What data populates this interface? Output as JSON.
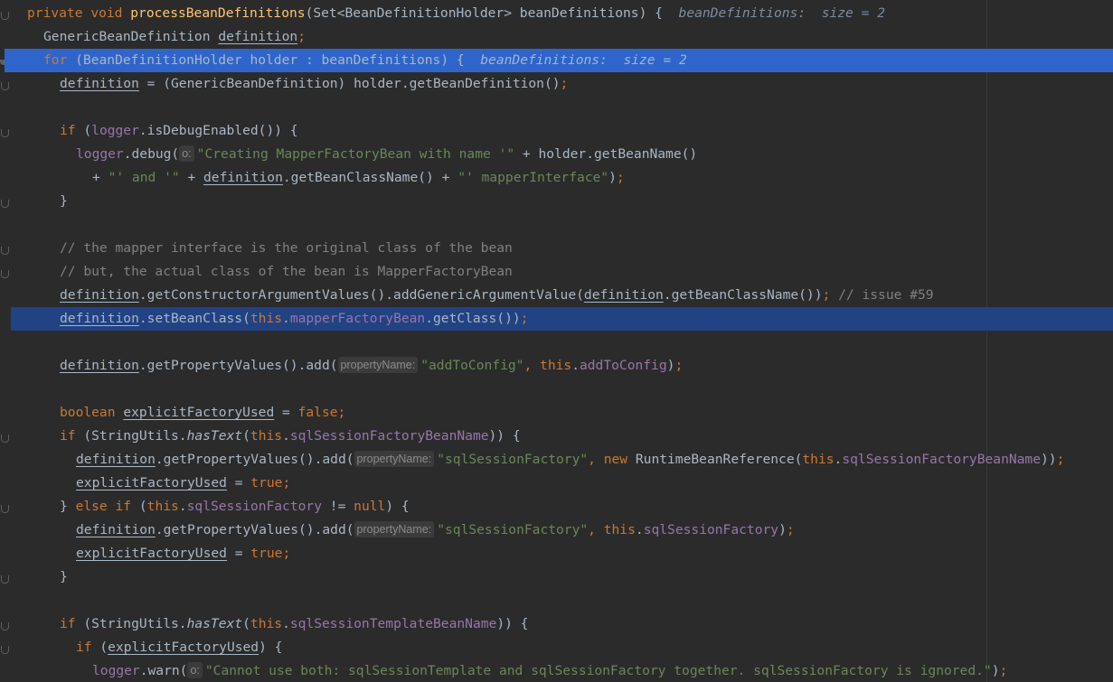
{
  "editor": {
    "method_signature": {
      "kw_private": "private",
      "kw_void": "void",
      "method_name": "processBeanDefinitions",
      "params": "(Set<BeanDefinitionHolder> beanDefinitions) {",
      "debug_var": "beanDefinitions:",
      "debug_val": "size = 2"
    },
    "l2": {
      "type": "GenericBeanDefinition",
      "var": "definition",
      "semi": ";"
    },
    "l3": {
      "kw": "for",
      "text": "(BeanDefinitionHolder holder : beanDefinitions) {",
      "debug_var": "beanDefinitions:",
      "debug_val": "size = 2"
    },
    "l4": {
      "var": "definition",
      "rest": " = (GenericBeanDefinition) holder.getBeanDefinition()",
      "semi": ";"
    },
    "l6": {
      "kw": "if",
      "p1": " (",
      "fld": "logger",
      "p2": ".isDebugEnabled()) {"
    },
    "l7": {
      "fld": "logger",
      "p1": ".debug(",
      "hint": "o:",
      "str": "\"Creating MapperFactoryBean with name '\"",
      "p2": " + holder.getBeanName()"
    },
    "l8": {
      "p1": "+ ",
      "str1": "\"' and '\"",
      "p2": " + ",
      "var": "definition",
      "p3": ".getBeanClassName() + ",
      "str2": "\"' mapperInterface\"",
      "p4": ")",
      "semi": ";"
    },
    "l9": {
      "brace": "}"
    },
    "l11": {
      "cmt": "// the mapper interface is the original class of the bean"
    },
    "l12": {
      "cmt": "// but, the actual class of the bean is MapperFactoryBean"
    },
    "l13": {
      "var1": "definition",
      "p1": ".getConstructorArgumentValues().addGenericArgumentValue(",
      "var2": "definition",
      "p2": ".getBeanClassName())",
      "semi": ";",
      "cmt": " // issue #59"
    },
    "l14": {
      "var": "definition",
      "p1": ".setBeanClass(",
      "kw": "this",
      "p2": ".",
      "fld": "mapperFactoryBean",
      "p3": ".getClass())",
      "semi": ";"
    },
    "l16": {
      "var": "definition",
      "p1": ".getPropertyValues().add(",
      "hint": "propertyName:",
      "str": "\"addToConfig\"",
      "p2": ", ",
      "kw": "this",
      "p3": ".",
      "fld": "addToConfig",
      "p4": ")",
      "semi": ";"
    },
    "l18": {
      "kw1": "boolean",
      "var": "explicitFactoryUsed",
      "p1": " = ",
      "kw2": "false",
      "semi": ";"
    },
    "l19": {
      "kw1": "if",
      "p1": " (StringUtils.",
      "method": "hasText",
      "p2": "(",
      "kw2": "this",
      "p3": ".",
      "fld": "sqlSessionFactoryBeanName",
      "p4": ")) {"
    },
    "l20": {
      "var": "definition",
      "p1": ".getPropertyValues().add(",
      "hint": "propertyName:",
      "str": "\"sqlSessionFactory\"",
      "p2": ", ",
      "kw1": "new",
      "p3": " RuntimeBeanReference(",
      "kw2": "this",
      "p4": ".",
      "fld": "sqlSessionFactoryBeanName",
      "p5": "))",
      "semi": ";"
    },
    "l21": {
      "var": "explicitFactoryUsed",
      "p1": " = ",
      "kw": "true",
      "semi": ";"
    },
    "l22": {
      "p1": "} ",
      "kw1": "else if",
      "p2": " (",
      "kw2": "this",
      "p3": ".",
      "fld": "sqlSessionFactory",
      "p4": " != ",
      "kw3": "null",
      "p5": ") {"
    },
    "l23": {
      "var": "definition",
      "p1": ".getPropertyValues().add(",
      "hint": "propertyName:",
      "str": "\"sqlSessionFactory\"",
      "p2": ", ",
      "kw": "this",
      "p3": ".",
      "fld": "sqlSessionFactory",
      "p4": ")",
      "semi": ";"
    },
    "l24": {
      "var": "explicitFactoryUsed",
      "p1": " = ",
      "kw": "true",
      "semi": ";"
    },
    "l25": {
      "brace": "}"
    },
    "l27": {
      "kw1": "if",
      "p1": " (StringUtils.",
      "method": "hasText",
      "p2": "(",
      "kw2": "this",
      "p3": ".",
      "fld": "sqlSessionTemplateBeanName",
      "p4": ")) {"
    },
    "l28": {
      "kw": "if",
      "p1": " (",
      "var": "explicitFactoryUsed",
      "p2": ") {"
    },
    "l29": {
      "fld": "logger",
      "p1": ".warn(",
      "hint": "o:",
      "str": "\"Cannot use both: sqlSessionTemplate and sqlSessionFactory together. sqlSessionFactory is ignored.\"",
      "p2": ")",
      "semi": ";"
    }
  }
}
